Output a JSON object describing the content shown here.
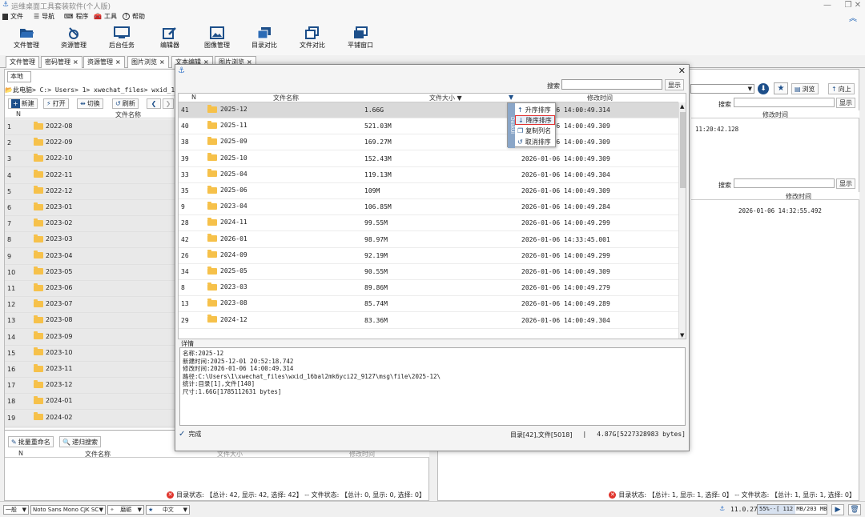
{
  "app": {
    "title": "运维桌面工具套装软件(个人版)"
  },
  "menu": [
    {
      "label": "文件",
      "icon": "file-icon"
    },
    {
      "label": "导航",
      "icon": "menu-lines-icon"
    },
    {
      "label": "程序",
      "icon": "keyboard-icon"
    },
    {
      "label": "工具",
      "icon": "toolbox-icon"
    },
    {
      "label": "帮助",
      "icon": "help-icon"
    }
  ],
  "toolbar": [
    "文件管理",
    "资源管理",
    "后台任务",
    "编辑器",
    "图像管理",
    "目录对比",
    "文件对比",
    "平铺窗口"
  ],
  "tabs": [
    "文件管理",
    "密码管理",
    "资源管理",
    "图片浏览",
    "文本编辑",
    "图片浏览"
  ],
  "left": {
    "subtab": "本地",
    "path": "此电脑> C:> Users> 1> xwechat_files> wxid_16bal2mk",
    "buttons": {
      "new": "新建",
      "open": "打开",
      "switch": "切换",
      "refresh": "刷新"
    },
    "cols": {
      "n": "N",
      "name": "文件名称"
    },
    "rows": [
      [
        "1",
        "2022-08"
      ],
      [
        "2",
        "2022-09"
      ],
      [
        "3",
        "2022-10"
      ],
      [
        "4",
        "2022-11"
      ],
      [
        "5",
        "2022-12"
      ],
      [
        "6",
        "2023-01"
      ],
      [
        "7",
        "2023-02"
      ],
      [
        "8",
        "2023-03"
      ],
      [
        "9",
        "2023-04"
      ],
      [
        "10",
        "2023-05"
      ],
      [
        "11",
        "2023-06"
      ],
      [
        "12",
        "2023-07"
      ],
      [
        "13",
        "2023-08"
      ],
      [
        "14",
        "2023-09"
      ],
      [
        "15",
        "2023-10"
      ],
      [
        "16",
        "2023-11"
      ],
      [
        "17",
        "2023-12"
      ],
      [
        "18",
        "2024-01"
      ],
      [
        "19",
        "2024-02"
      ]
    ],
    "batch_rename": "批量重命名",
    "recursive_search": "递归搜索",
    "lower_cols": {
      "n": "N",
      "name": "文件名称",
      "size": "文件大小",
      "mtime": "修改时间"
    },
    "status": "目录状态: 【总计: 42, 显示: 42, 选择: 42】 -- 文件状态: 【总计: 0, 显示: 0, 选择: 0】"
  },
  "right": {
    "browse": "浏览",
    "up": "向上",
    "search_label": "搜索",
    "show_btn": "显示",
    "col_mtime": "修改时间",
    "row1_time": "11:20:42.128",
    "search_label2": "搜索",
    "show_btn2": "显示",
    "col_mtime2": "修改时间",
    "row2_time": "2026-01-06 14:32:55.492",
    "status": "目录状态: 【总计: 1, 显示: 1, 选择: 0】 -- 文件状态: 【总计: 1, 显示: 1, 选择: 0】"
  },
  "dialog": {
    "search_label": "搜索",
    "search_value": "",
    "show_btn": "显示",
    "cols": {
      "n": "N",
      "name": "文件名称",
      "size": "文件大小",
      "mtime": "修改时间"
    },
    "rows": [
      [
        "41",
        "2025-12",
        "1.66G",
        "2026-01-06 14:00:49.314"
      ],
      [
        "40",
        "2025-11",
        "521.03M",
        "2026-01-06 14:00:49.309"
      ],
      [
        "38",
        "2025-09",
        "169.27M",
        "2026-01-06 14:00:49.309"
      ],
      [
        "39",
        "2025-10",
        "152.43M",
        "2026-01-06 14:00:49.309"
      ],
      [
        "33",
        "2025-04",
        "119.13M",
        "2026-01-06 14:00:49.304"
      ],
      [
        "35",
        "2025-06",
        "109M",
        "2026-01-06 14:00:49.309"
      ],
      [
        "9",
        "2023-04",
        "106.85M",
        "2026-01-06 14:00:49.284"
      ],
      [
        "28",
        "2024-11",
        "99.55M",
        "2026-01-06 14:00:49.299"
      ],
      [
        "42",
        "2026-01",
        "98.97M",
        "2026-01-06 14:33:45.001"
      ],
      [
        "26",
        "2024-09",
        "92.19M",
        "2026-01-06 14:00:49.299"
      ],
      [
        "34",
        "2025-05",
        "90.55M",
        "2026-01-06 14:00:49.309"
      ],
      [
        "8",
        "2023-03",
        "89.86M",
        "2026-01-06 14:00:49.279"
      ],
      [
        "13",
        "2023-08",
        "85.74M",
        "2026-01-06 14:00:49.289"
      ],
      [
        "29",
        "2024-12",
        "83.36M",
        "2026-01-06 14:00:49.304"
      ]
    ],
    "ctx": {
      "asc": "升序排序",
      "desc": "降序排序",
      "copy": "复制列名",
      "cancel": "取消排序",
      "side": "DeskUI"
    },
    "detail_title": "详情",
    "detail": [
      "名称:2025-12",
      "新建时间:2025-12-01 20:52:18.742",
      "修改时间:2026-01-06 14:00:49.314",
      "路径:C:\\Users\\1\\xwechat_files\\wxid_16bal2mk6yci22_9127\\msg\\file\\2025-12\\",
      "统计:目录[1],文件[140]",
      "尺寸:1.66G[1785112631 bytes]"
    ],
    "done": "完成",
    "summary": "目录[42],文件[5018]",
    "total": "4.87G[5227328983 bytes]"
  },
  "bottom": {
    "mode": "一般",
    "font": "Noto Sans Mono CJK SC",
    "style": "磨砺",
    "lang": "中文",
    "version": "11.0.27",
    "mem": "55%--[ 112 MB/203 MB ]"
  }
}
